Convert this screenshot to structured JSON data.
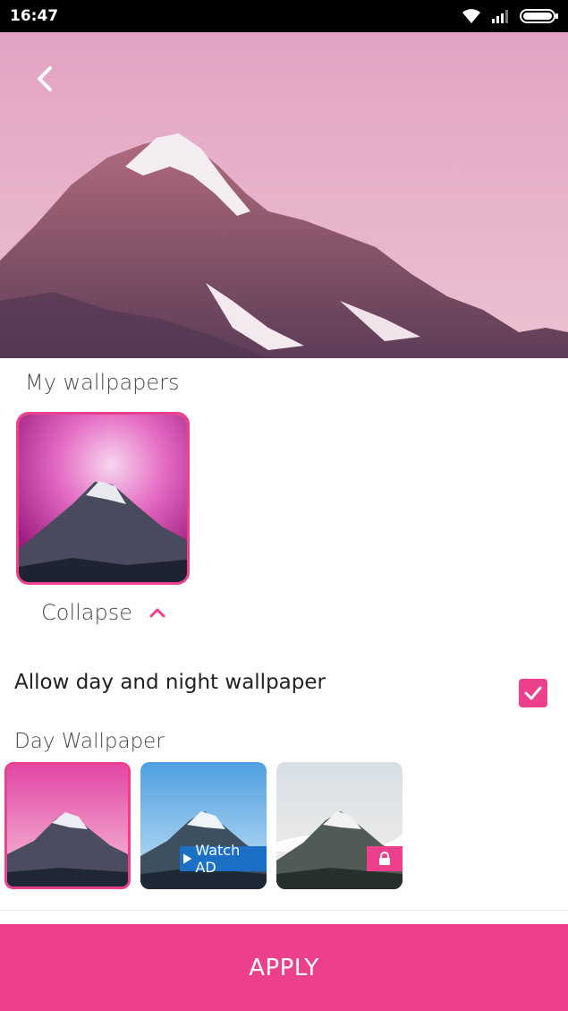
{
  "status_bar": {
    "time": "16:47",
    "icons": [
      "wifi-icon",
      "signal-icon",
      "battery-icon"
    ]
  },
  "header": {
    "back_icon": "back-arrow-icon"
  },
  "my_wallpapers": {
    "title": "My wallpapers",
    "collapse_label": "Collapse",
    "collapse_icon": "chevron-up-icon"
  },
  "day_night": {
    "label": "Allow day and night wallpaper",
    "checked": true
  },
  "day_wallpaper": {
    "title": "Day Wallpaper",
    "items": [
      {
        "state": "selected"
      },
      {
        "badge": "Watch AD",
        "badge_icon": "play-icon"
      },
      {
        "badge_icon": "lock-icon"
      }
    ]
  },
  "apply": {
    "label": "APPLY"
  },
  "colors": {
    "accent": "#ec3f8c",
    "watch_ad": "#1b6fc4",
    "status_bar": "#000000"
  }
}
